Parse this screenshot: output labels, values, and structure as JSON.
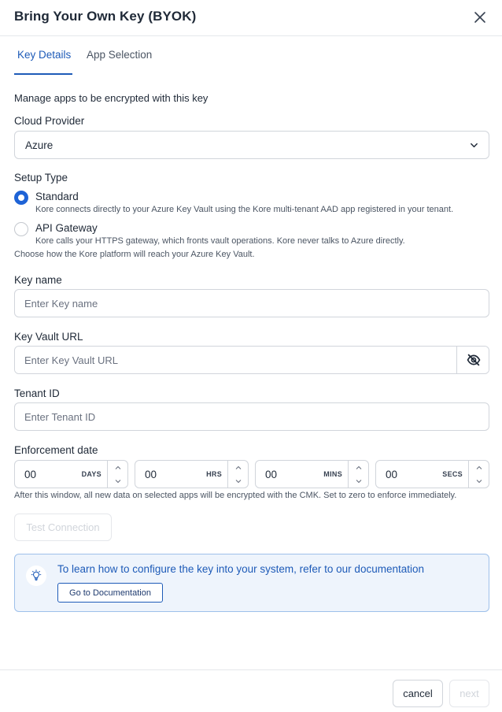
{
  "modal": {
    "title": "Bring Your Own Key (BYOK)",
    "close_icon": "close-icon"
  },
  "tabs": [
    {
      "label": "Key Details",
      "active": true
    },
    {
      "label": "App Selection",
      "active": false
    }
  ],
  "description": "Manage apps to be encrypted with this key",
  "cloud_provider": {
    "label": "Cloud Provider",
    "value": "Azure",
    "icon": "chevron-down-icon"
  },
  "setup_type": {
    "label": "Setup Type",
    "options": [
      {
        "label": "Standard",
        "help": "Kore connects directly to your Azure Key Vault using the Kore multi-tenant AAD app registered in your tenant.",
        "selected": true
      },
      {
        "label": "API Gateway",
        "help": "Kore calls your HTTPS gateway, which fronts vault operations. Kore never talks to Azure directly.",
        "selected": false
      }
    ],
    "hint": "Choose how the Kore platform will reach your Azure Key Vault."
  },
  "key_name": {
    "label": "Key name",
    "value": "",
    "placeholder": "Enter Key name"
  },
  "key_vault_url": {
    "label": "Key Vault URL",
    "value": "",
    "placeholder": "Enter Key Vault URL",
    "icon": "eye-off-icon"
  },
  "tenant_id": {
    "label": "Tenant ID",
    "value": "",
    "placeholder": "Enter Tenant ID"
  },
  "enforcement": {
    "label": "Enforcement date",
    "fields": [
      {
        "value": "00",
        "unit": "DAYS"
      },
      {
        "value": "00",
        "unit": "HRS"
      },
      {
        "value": "00",
        "unit": "MINS"
      },
      {
        "value": "00",
        "unit": "SECS"
      }
    ],
    "hint": "After this window, all new data on selected apps will be encrypted with the CMK. Set to zero to enforce immediately."
  },
  "test_connection_label": "Test Connection",
  "info": {
    "icon": "lightbulb-icon",
    "text": "To learn how to configure the key into your system, refer to our documentation",
    "button_label": "Go to Documentation"
  },
  "footer": {
    "cancel_label": "cancel",
    "next_label": "next"
  },
  "colors": {
    "accent": "#1e5bb8",
    "radio": "#1e63d6",
    "info_bg": "#eef4fc",
    "info_border": "#9ec0ea"
  }
}
